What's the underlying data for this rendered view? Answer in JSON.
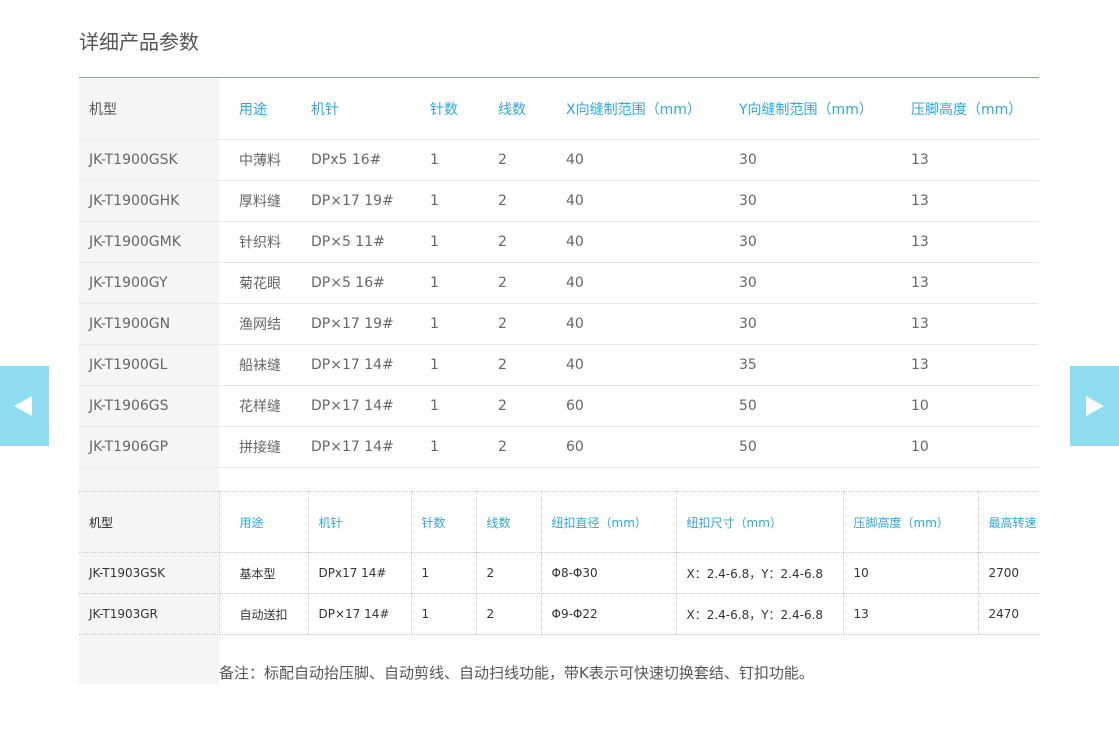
{
  "section_title": "详细产品参数",
  "table1": {
    "headers": [
      "机型",
      "用途",
      "机针",
      "针数",
      "线数",
      "X向缝制范围（mm）",
      "Y向缝制范围（mm）",
      "压脚高度（mm）"
    ],
    "rows": [
      [
        "JK-T1900GSK",
        "中薄料",
        "DPx5 16#",
        "1",
        "2",
        "40",
        "30",
        "13"
      ],
      [
        "JK-T1900GHK",
        "厚料缝",
        "DP×17 19#",
        "1",
        "2",
        "40",
        "30",
        "13"
      ],
      [
        "JK-T1900GMK",
        "针织料",
        "DP×5  11#",
        "1",
        "2",
        "40",
        "30",
        "13"
      ],
      [
        "JK-T1900GY",
        "菊花眼",
        "DP×5 16#",
        "1",
        "2",
        "40",
        "30",
        "13"
      ],
      [
        "JK-T1900GN",
        "渔网结",
        "DP×17  19#",
        "1",
        "2",
        "40",
        "30",
        "13"
      ],
      [
        "JK-T1900GL",
        "船袜缝",
        "DP×17 14#",
        "1",
        "2",
        "40",
        "35",
        "13"
      ],
      [
        "JK-T1906GS",
        "花样缝",
        "DP×17 14#",
        "1",
        "2",
        "60",
        "50",
        "10"
      ],
      [
        "JK-T1906GP",
        "拼接缝",
        "DP×17 14#",
        "1",
        "2",
        "60",
        "50",
        "10"
      ]
    ]
  },
  "table2": {
    "headers": [
      "机型",
      "用途",
      "机针",
      "针数",
      "线数",
      "纽扣直径（mm）",
      "纽扣尺寸（mm）",
      "压脚高度（mm）",
      "最高转速"
    ],
    "rows": [
      [
        "JK-T1903GSK",
        "基本型",
        "DPx17 14#",
        "1",
        "2",
        "Φ8-Φ30",
        "X：2.4-6.8，Y：2.4-6.8",
        "10",
        "2700"
      ],
      [
        "JK-T1903GR",
        "自动送扣",
        "DP×17 14#",
        "1",
        "2",
        "Φ9-Φ22",
        "X：2.4-6.8，Y：2.4-6.8",
        "13",
        "2470"
      ]
    ]
  },
  "note": "备注：标配自动抬压脚、自动剪线、自动扫线功能，带K表示可快速切换套结、钉扣功能。",
  "nav": {
    "prev_icon": "arrow-left-icon",
    "next_icon": "arrow-right-icon",
    "arrow_color": "#8ddcf0",
    "accent": "#2ea7e0"
  }
}
